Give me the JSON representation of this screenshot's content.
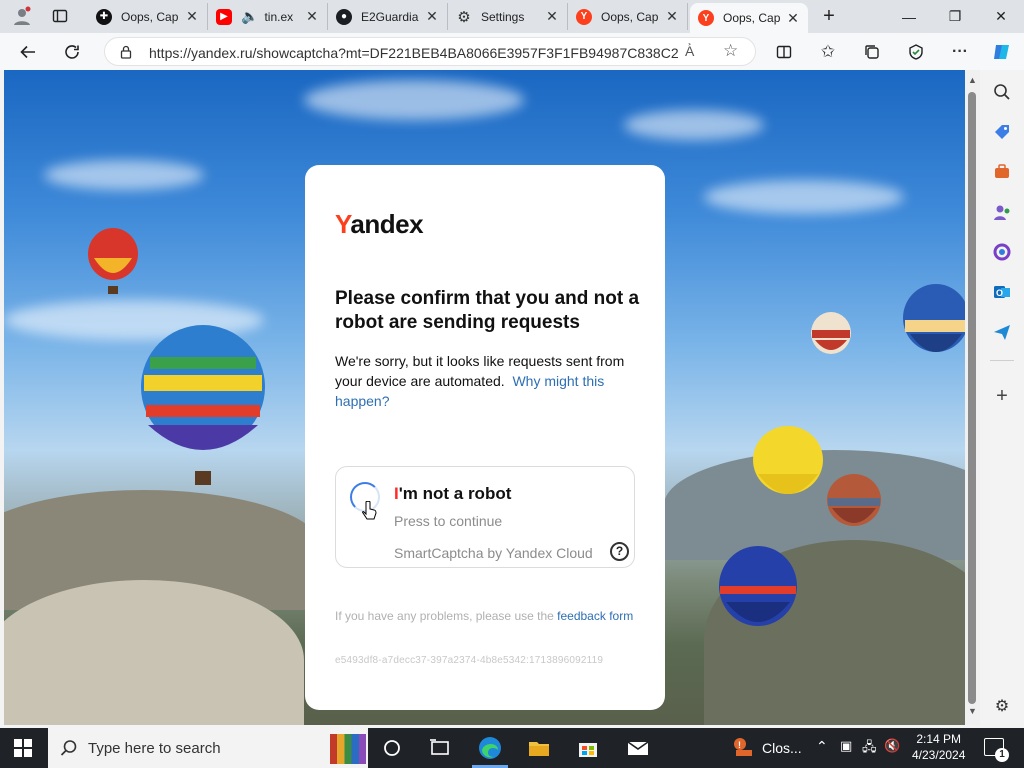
{
  "tabs": [
    {
      "title": "Oops, Cap",
      "icon": "plus-circle-icon"
    },
    {
      "title": "tin.ex",
      "icon": "youtube-icon"
    },
    {
      "title": "E2Guardia",
      "icon": "github-icon"
    },
    {
      "title": "Settings",
      "icon": "gear-icon"
    },
    {
      "title": "Oops, Cap",
      "icon": "yandex-icon"
    },
    {
      "title": "Oops, Cap",
      "icon": "yandex-icon",
      "active": true
    }
  ],
  "address": {
    "url": "https://yandex.ru/showcaptcha?mt=DF221BEB4BA8066E3957F3F1FB94987C838C2..."
  },
  "card": {
    "logo_first": "Y",
    "logo_rest": "andex",
    "heading": "Please confirm that you and not a robot are sending requests",
    "desc": "We're sorry, but it looks like requests sent from your device are automated.",
    "why_link": "Why might this happen?",
    "captcha": {
      "title_first": "I",
      "title_rest": "'m not a robot",
      "subtitle": "Press to continue",
      "provider": "SmartCaptcha by Yandex Cloud",
      "help": "?"
    },
    "problems_text": "If you have any problems, please use the",
    "feedback_link": "feedback form",
    "request_id": "e5493df8-a7decc37-397a2374-4b8e5342:1713896092119"
  },
  "taskbar": {
    "search_placeholder": "Type here to search",
    "app_label": "Clos...",
    "time": "2:14 PM",
    "date": "4/23/2024",
    "notification_count": "1"
  },
  "colors": {
    "yandex_red": "#fc3f1d",
    "link_blue": "#2e6fb3",
    "spinner_blue": "#3d7ee6"
  }
}
